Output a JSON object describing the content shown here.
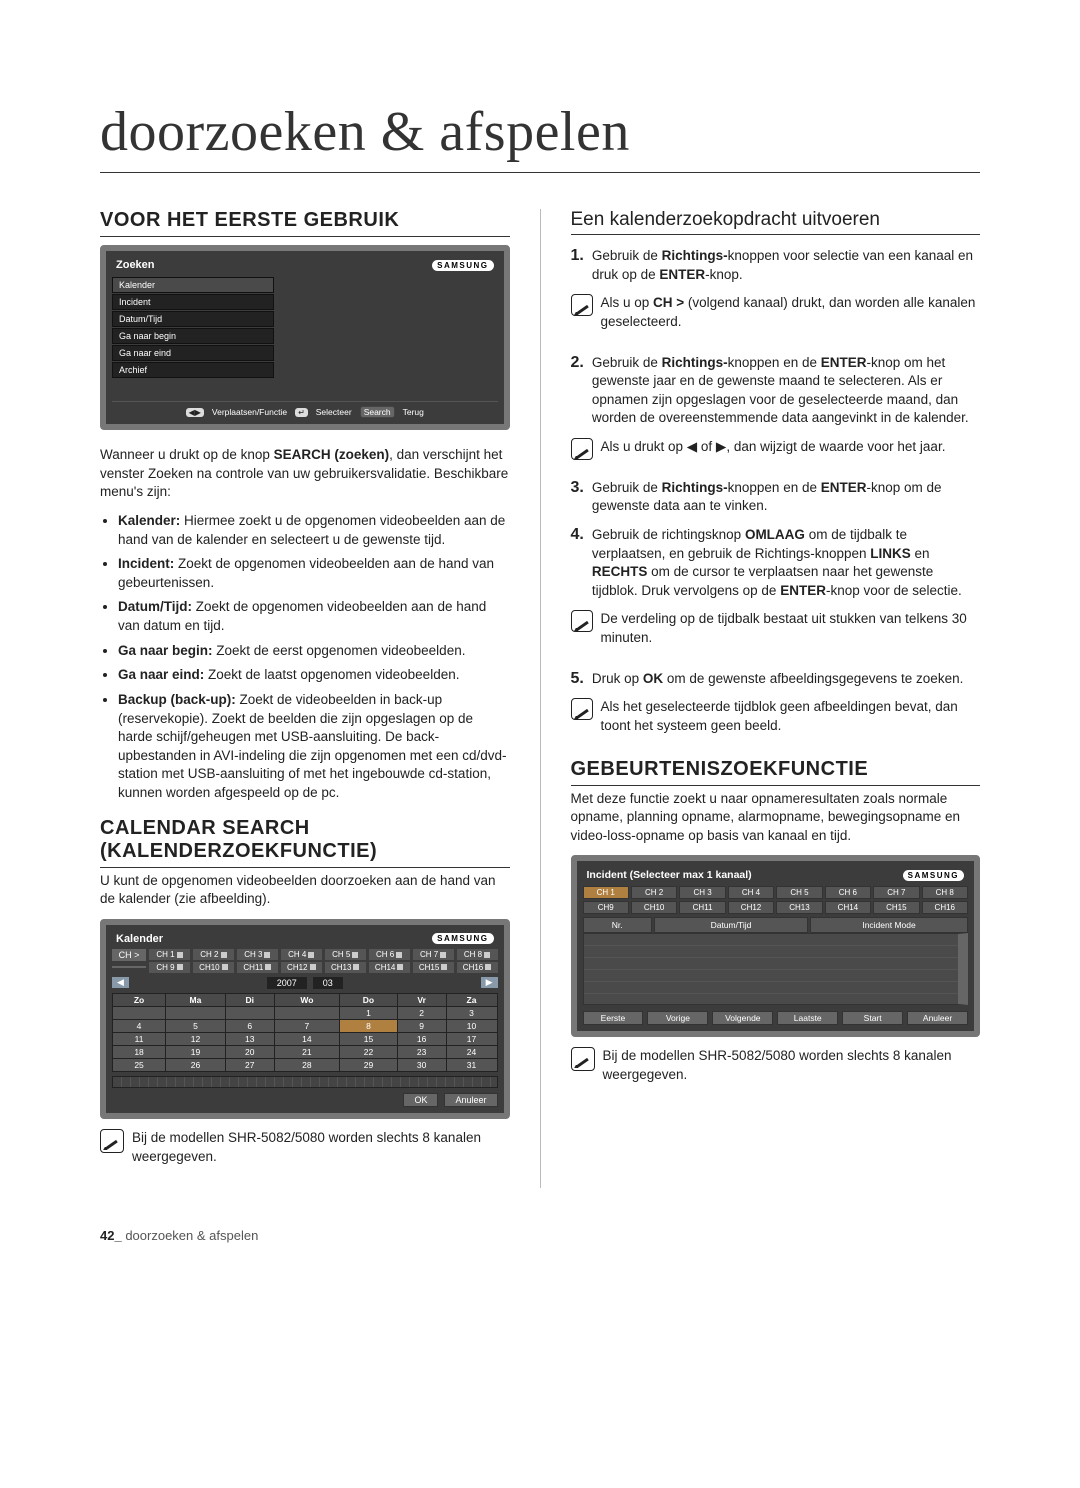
{
  "page": {
    "title": "doorzoeken & afspelen",
    "footer_page": "42_",
    "footer_text": "doorzoeken & afspelen"
  },
  "left": {
    "section1_title": "VOOR HET EERSTE GEBRUIK",
    "zoeken_panel": {
      "title": "Zoeken",
      "brand": "SAMSUNG",
      "menu": [
        "Kalender",
        "Incident",
        "Datum/Tijd",
        "Ga naar begin",
        "Ga naar eind",
        "Archief"
      ],
      "footer_move": "Verplaatsen/Functie",
      "footer_select": "Selecteer",
      "footer_search": "Search",
      "footer_back": "Terug"
    },
    "intro_para_prefix": "Wanneer u drukt op de knop ",
    "intro_bold": "SEARCH (zoeken)",
    "intro_suffix": ", dan verschijnt het venster Zoeken na controle van uw gebruikersvalidatie. Beschikbare menu's zijn:",
    "bullets": [
      {
        "b": "Kalender:",
        "t": " Hiermee zoekt u de opgenomen videobeelden aan de hand van de kalender en selecteert u de gewenste tijd."
      },
      {
        "b": "Incident:",
        "t": " Zoekt de opgenomen videobeelden aan de hand van gebeurtenissen."
      },
      {
        "b": "Datum/Tijd:",
        "t": " Zoekt de opgenomen videobeelden aan de hand van datum en tijd."
      },
      {
        "b": "Ga naar begin:",
        "t": " Zoekt de eerst opgenomen videobeelden."
      },
      {
        "b": "Ga naar eind:",
        "t": " Zoekt de laatst opgenomen videobeelden."
      },
      {
        "b": "Backup (back-up):",
        "t": " Zoekt de videobeelden in back-up (reservekopie). Zoekt de beelden die zijn opgeslagen op de harde schijf/geheugen met USB-aansluiting. De back-upbestanden in AVI-indeling die zijn opgenomen met een cd/dvd-station met USB-aansluiting of met het ingebouwde cd-station, kunnen worden afgespeeld op de pc."
      }
    ],
    "section2_title": "CALENDAR SEARCH (KALENDERZOEKFUNCTIE)",
    "section2_intro": "U kunt de opgenomen videobeelden doorzoeken aan de hand van de kalender (zie afbeelding).",
    "cal_panel": {
      "title": "Kalender",
      "brand": "SAMSUNG",
      "ch_label": "CH >",
      "ch_row1": [
        "CH 1",
        "CH 2",
        "CH 3",
        "CH 4",
        "CH 5",
        "CH 6",
        "CH 7",
        "CH 8"
      ],
      "ch_row2": [
        "CH 9",
        "CH10",
        "CH11",
        "CH12",
        "CH13",
        "CH14",
        "CH15",
        "CH16"
      ],
      "year": "2007",
      "month": "03",
      "dow": [
        "Zo",
        "Ma",
        "Di",
        "Wo",
        "Do",
        "Vr",
        "Za"
      ],
      "weeks": [
        [
          "",
          "",
          "",
          "",
          "1",
          "2",
          "3"
        ],
        [
          "4",
          "5",
          "6",
          "7",
          "8",
          "9",
          "10"
        ],
        [
          "11",
          "12",
          "13",
          "14",
          "15",
          "16",
          "17"
        ],
        [
          "18",
          "19",
          "20",
          "21",
          "22",
          "23",
          "24"
        ],
        [
          "25",
          "26",
          "27",
          "28",
          "29",
          "30",
          "31"
        ]
      ],
      "ok": "OK",
      "cancel": "Anuleer"
    },
    "section2_note": "Bij de modellen SHR-5082/5080 worden slechts 8 kanalen weergegeven."
  },
  "right": {
    "sub_title": "Een kalenderzoekopdracht uitvoeren",
    "steps": [
      {
        "n": "1.",
        "html": "Gebruik de <b>Richtings-</b>knoppen voor selectie van een kanaal en druk op de <b>ENTER</b>-knop."
      },
      {
        "note": true,
        "html": "Als u op <b>CH ></b> (volgend kanaal) drukt, dan worden alle kanalen geselecteerd."
      },
      {
        "n": "2.",
        "html": "Gebruik de <b>Richtings-</b>knoppen en de <b>ENTER</b>-knop om het gewenste jaar en de gewenste maand te selecteren. Als er opnamen zijn opgeslagen voor de geselecteerde maand, dan worden de overeenstemmende data aangevinkt in de kalender."
      },
      {
        "note": true,
        "html": "Als u drukt op ◀ of ▶, dan wijzigt de waarde voor het jaar."
      },
      {
        "n": "3.",
        "html": "Gebruik de <b>Richtings-</b>knoppen en de <b>ENTER</b>-knop om de gewenste data aan te vinken."
      },
      {
        "n": "4.",
        "html": "Gebruik de richtingsknop <b>OMLAAG</b> om de tijdbalk te verplaatsen, en gebruik de Richtings-knoppen <b>LINKS</b> en <b>RECHTS</b> om de cursor te verplaatsen naar het gewenste tijdblok. Druk vervolgens op de <b>ENTER</b>-knop voor de selectie."
      },
      {
        "note": true,
        "html": "De verdeling op de tijdbalk bestaat uit stukken van telkens 30 minuten."
      },
      {
        "n": "5.",
        "html": "Druk op <b>OK</b> om de gewenste afbeeldingsgegevens te zoeken."
      },
      {
        "note": true,
        "html": "Als het geselecteerde tijdblok geen afbeeldingen bevat, dan toont het systeem geen beeld."
      }
    ],
    "section3_title": "GEBEURTENISZOEKFUNCTIE",
    "section3_intro": "Met deze functie zoekt u naar opnameresultaten zoals normale opname, planning opname, alarmopname, bewegingsopname en video-loss-opname op basis van kanaal en tijd.",
    "inc_panel": {
      "title": "Incident (Selecteer max 1 kanaal)",
      "brand": "SAMSUNG",
      "ch_row1": [
        "CH 1",
        "CH 2",
        "CH 3",
        "CH 4",
        "CH 5",
        "CH 6",
        "CH 7",
        "CH 8"
      ],
      "ch_row2": [
        "CH9",
        "CH10",
        "CH11",
        "CH12",
        "CH13",
        "CH14",
        "CH15",
        "CH16"
      ],
      "cols": [
        "Nr.",
        "Datum/Tijd",
        "Incident Mode"
      ],
      "actions": [
        "Eerste",
        "Vorige",
        "Volgende",
        "Laatste",
        "Start",
        "Anuleer"
      ]
    },
    "section3_note": "Bij de modellen SHR-5082/5080 worden slechts 8 kanalen weergegeven."
  }
}
